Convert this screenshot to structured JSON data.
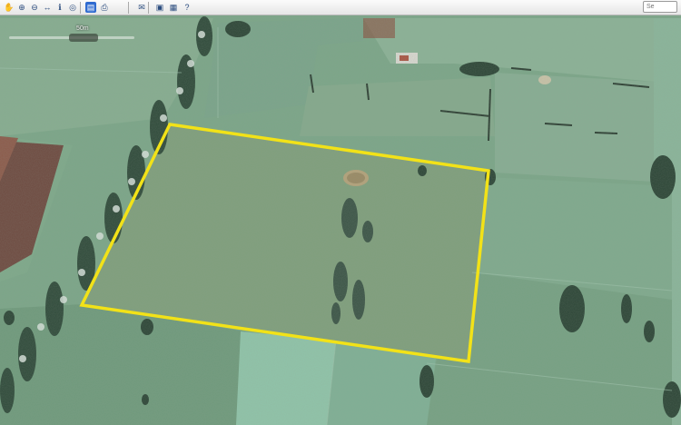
{
  "toolbar": {
    "tools": [
      {
        "icon": "pan-hand-icon",
        "glyph": "✋"
      },
      {
        "icon": "zoom-in-icon",
        "glyph": "⊕"
      },
      {
        "icon": "zoom-out-icon",
        "glyph": "⊖"
      },
      {
        "icon": "measure-icon",
        "glyph": "↔"
      },
      {
        "icon": "identify-icon",
        "glyph": "ℹ"
      },
      {
        "icon": "globe-icon",
        "glyph": "◎"
      },
      {
        "icon": "layers-icon",
        "glyph": "▤"
      },
      {
        "icon": "print-icon",
        "glyph": "⎙"
      },
      {
        "icon": "email-icon",
        "glyph": "✉"
      },
      {
        "icon": "save-icon",
        "glyph": "▣"
      },
      {
        "icon": "export-icon",
        "glyph": "▦"
      },
      {
        "icon": "help-icon",
        "glyph": "?"
      }
    ],
    "search_placeholder": "Se"
  },
  "map": {
    "zoom_label": "50m",
    "zoom_level": 0.62,
    "boundary_color": "#f2e218"
  }
}
